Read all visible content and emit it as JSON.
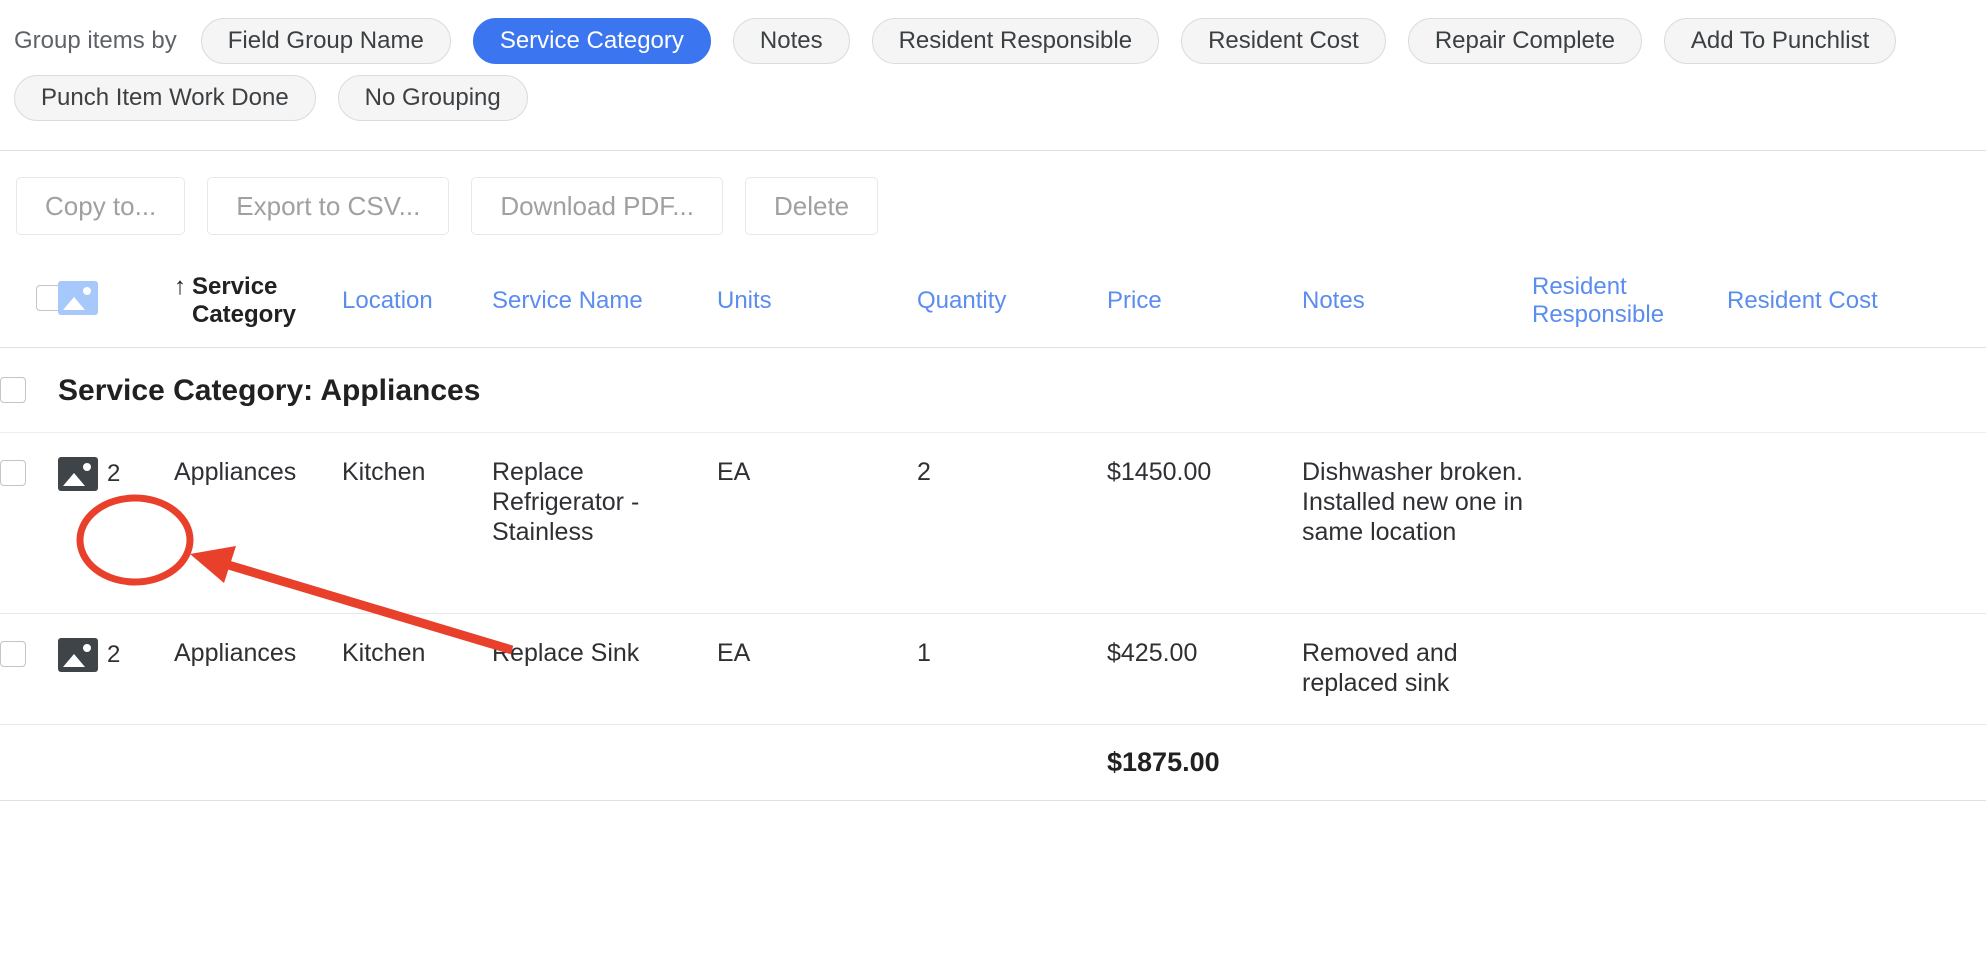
{
  "group_bar": {
    "label": "Group items by",
    "chips": [
      {
        "label": "Field Group Name",
        "active": false
      },
      {
        "label": "Service Category",
        "active": true
      },
      {
        "label": "Notes",
        "active": false
      },
      {
        "label": "Resident Responsible",
        "active": false
      },
      {
        "label": "Resident Cost",
        "active": false
      },
      {
        "label": "Repair Complete",
        "active": false
      },
      {
        "label": "Add To Punchlist",
        "active": false
      },
      {
        "label": "Punch Item Work Done",
        "active": false
      },
      {
        "label": "No Grouping",
        "active": false
      }
    ],
    "active_color": "#3b76f0"
  },
  "actions": [
    {
      "label": "Copy to..."
    },
    {
      "label": "Export to CSV..."
    },
    {
      "label": "Download PDF..."
    },
    {
      "label": "Delete"
    }
  ],
  "table": {
    "image_column_icon": "image-icon",
    "sort_indicator": "↑",
    "headers": [
      {
        "label": "Service Category",
        "sorted": true
      },
      {
        "label": "Location",
        "sorted": false
      },
      {
        "label": "Service Name",
        "sorted": false
      },
      {
        "label": "Units",
        "sorted": false
      },
      {
        "label": "Quantity",
        "sorted": false
      },
      {
        "label": "Price",
        "sorted": false
      },
      {
        "label": "Notes",
        "sorted": false
      },
      {
        "label": "Resident Responsible",
        "sorted": false
      },
      {
        "label": "Resident Cost",
        "sorted": false
      }
    ],
    "header_link_color": "#5b8dee",
    "group": {
      "title": "Service Category: Appliances"
    },
    "rows": [
      {
        "image_count": "2",
        "service_category": "Appliances",
        "location": "Kitchen",
        "service_name": "Replace Refrigerator - Stainless",
        "units": "EA",
        "quantity": "2",
        "price": "$1450.00",
        "notes": "Dishwasher broken. Installed new one in same location",
        "resident_responsible": "",
        "resident_cost": ""
      },
      {
        "image_count": "2",
        "service_category": "Appliances",
        "location": "Kitchen",
        "service_name": "Replace Sink",
        "units": "EA",
        "quantity": "1",
        "price": "$425.00",
        "notes": "Removed and replaced sink",
        "resident_responsible": "",
        "resident_cost": ""
      }
    ],
    "total": "$1875.00"
  },
  "annotation": {
    "color": "#e8402a",
    "shape": "ellipse-with-arrow",
    "target": "image-count-cell-row-1"
  }
}
